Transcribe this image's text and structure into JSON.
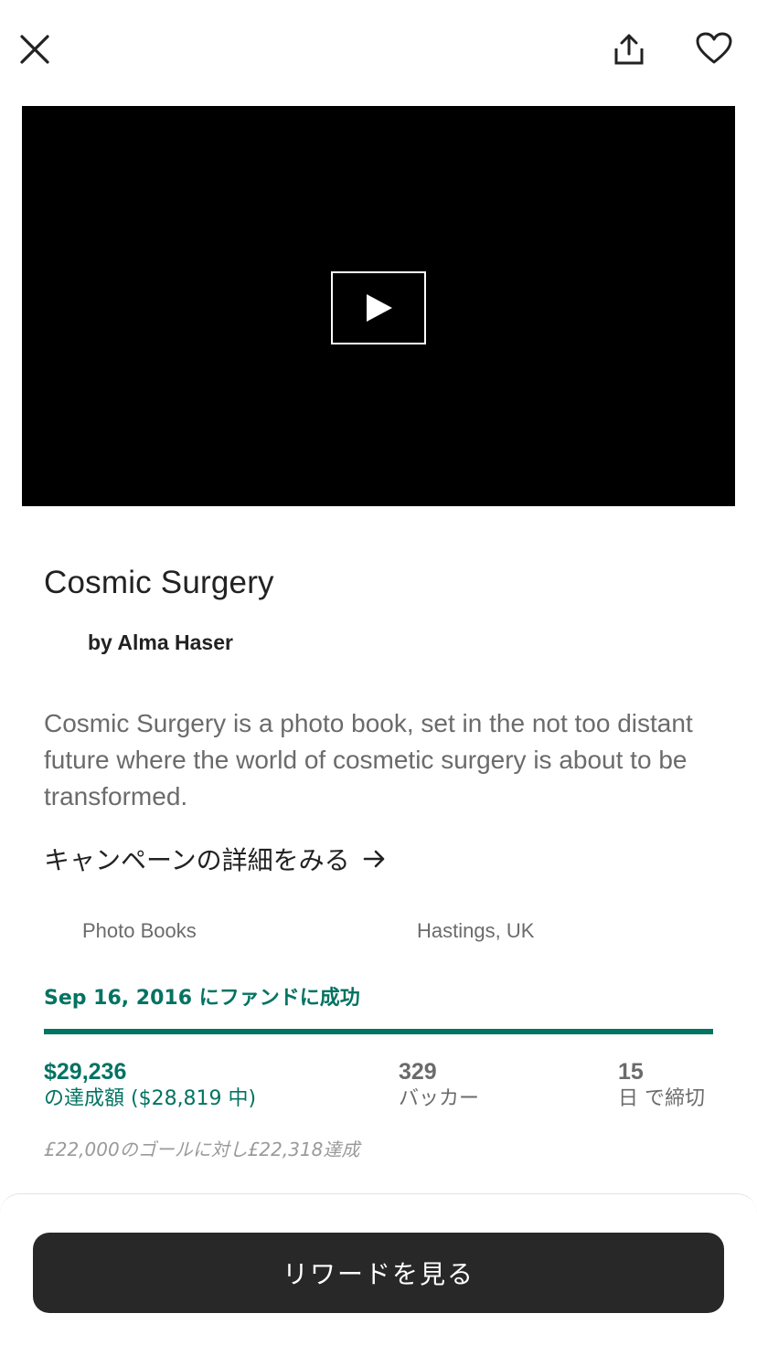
{
  "project": {
    "title": "Cosmic Surgery",
    "creator": "by Alma Haser",
    "blurb": "Cosmic Surgery is a photo book, set in the not too distant future where the world of cosmetic surgery is about to be transformed.",
    "details_link": "キャンペーンの詳細をみる",
    "category": "Photo Books",
    "location": "Hastings, UK"
  },
  "funding": {
    "status": "Sep 16, 2016 にファンドに成功",
    "progress_fraction": 1.0,
    "pledged": "$29,236",
    "pledged_label": "の達成額 ($28,819 中)",
    "backers": "329",
    "backers_label": "バッカー",
    "days": "15",
    "days_label": "日 で締切",
    "conversion_note": "£22,000のゴールに対し£22,318達成"
  },
  "footer": {
    "cta_label": "リワードを見る"
  },
  "colors": {
    "accent": "#037362",
    "cta_bg": "#282828",
    "video_bg": "#000000"
  },
  "icons": {
    "close": "close-icon",
    "share": "share-icon",
    "favorite": "heart-icon",
    "play": "play-icon",
    "arrow": "arrow-right-icon"
  }
}
